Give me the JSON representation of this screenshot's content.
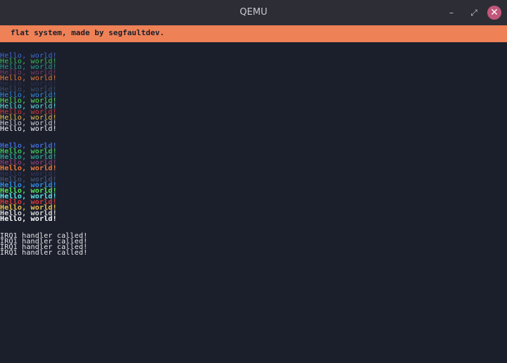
{
  "window": {
    "title": "QEMU",
    "minimize_label": "–",
    "maximize_label": "⤢",
    "close_label": "✕"
  },
  "banner": {
    "text": "flat system, made by segfaultdev.",
    "color": "#ef8156"
  },
  "hello_text": "Hello, world!",
  "palette": [
    "#3f6bd6",
    "#3dbf5a",
    "#2f9a8a",
    "#7a3b6a",
    "#f07a3a",
    "#2b3050",
    "#3e4d6a",
    "#2f8ee8",
    "#57e85e",
    "#5fe8e8",
    "#d83a3a",
    "#f0c050",
    "#d7d7d7",
    "#ffffff"
  ],
  "regular_block": [
    {
      "text": "Hello, world!",
      "color": "#3f6bd6"
    },
    {
      "text": "Hello, world!",
      "color": "#3dbf5a"
    },
    {
      "text": "Hello, world!",
      "color": "#2f9a8a"
    },
    {
      "text": "Hello, world!",
      "color": "#7a3b6a"
    },
    {
      "text": "Hello, world!",
      "color": "#f07a3a"
    },
    {
      "text": "Hello, world!",
      "color": "#2b3050"
    },
    {
      "text": "Hello, world!",
      "color": "#3e4d6a"
    },
    {
      "text": "Hello, world!",
      "color": "#2f8ee8"
    },
    {
      "text": "Hello, world!",
      "color": "#57e85e"
    },
    {
      "text": "Hello, world!",
      "color": "#5fe8e8"
    },
    {
      "text": "Hello, world!",
      "color": "#d83a3a"
    },
    {
      "text": "Hello, world!",
      "color": "#f0c050"
    },
    {
      "text": "Hello, world!",
      "color": "#d7d7d7"
    },
    {
      "text": "Hello, world!",
      "color": "#ffffff"
    }
  ],
  "bold_block": [
    {
      "text": "Hello, world!",
      "color": "#3f6bd6"
    },
    {
      "text": "Hello, world!",
      "color": "#3dbf5a"
    },
    {
      "text": "Hello, world!",
      "color": "#2f9a8a"
    },
    {
      "text": "Hello, world!",
      "color": "#7a3b6a"
    },
    {
      "text": "Hello, world!",
      "color": "#f07a3a"
    },
    {
      "text": "Hello, world!",
      "color": "#2b3050"
    },
    {
      "text": "Hello, world!",
      "color": "#3e4d6a"
    },
    {
      "text": "Hello, world!",
      "color": "#2f8ee8"
    },
    {
      "text": "Hello, world!",
      "color": "#57e85e"
    },
    {
      "text": "Hello, world!",
      "color": "#5fe8e8"
    },
    {
      "text": "Hello, world!",
      "color": "#d83a3a"
    },
    {
      "text": "Hello, world!",
      "color": "#f0c050"
    },
    {
      "text": "Hello, world!",
      "color": "#d7d7d7"
    },
    {
      "text": "Hello, world!",
      "color": "#ffffff"
    }
  ],
  "irq_lines": [
    "IRQ1 handler called!",
    "IRQ1 handler called!",
    "IRQ1 handler called!",
    "IRQ1 handler called!"
  ],
  "irq_color": "#e8e8e8"
}
